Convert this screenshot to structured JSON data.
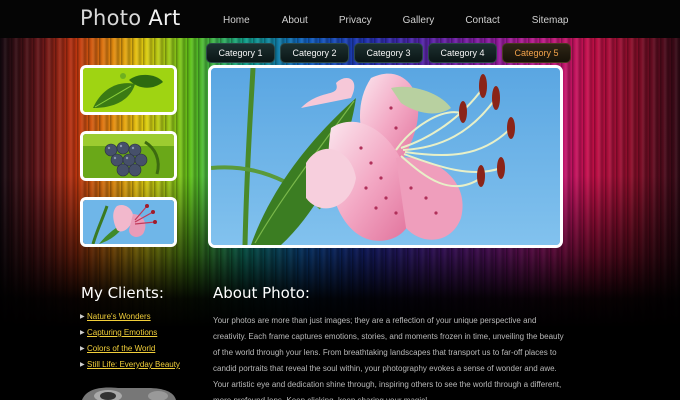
{
  "site": {
    "logo_part1": "Photo",
    "logo_part2": "Art"
  },
  "nav": [
    "Home",
    "About",
    "Privacy",
    "Gallery",
    "Contact",
    "Sitemap"
  ],
  "categories": [
    "Category 1",
    "Category 2",
    "Category 3",
    "Category 4",
    "Category 5"
  ],
  "active_category": "Category 5",
  "thumbnails": [
    "leaf-photo",
    "grapes-photo",
    "lily-photo"
  ],
  "featured_image": "pink-lily-photo",
  "clients": {
    "title": "My Clients:",
    "items": [
      "Nature's Wonders",
      "Capturing Emotions",
      "Colors of the World",
      "Still Life: Everyday Beauty"
    ]
  },
  "about": {
    "title": "About Photo:",
    "body": "Your photos are more than just images; they are a reflection of your unique perspective and creativity. Each frame captures emotions, stories, and moments frozen in time, unveiling the beauty of the world through your lens. From breathtaking landscapes that transport us to far-off places to candid portraits that reveal the soul within, your photography evokes a sense of wonder and awe. Your artistic eye and dedication shine through, inspiring others to see the world through a different, more profound lens. Keep clicking, keep sharing your magic!"
  },
  "colors": {
    "link": "#f2cf3a",
    "active_tab": "#f2a24a",
    "body_text": "#b9b9b9"
  }
}
